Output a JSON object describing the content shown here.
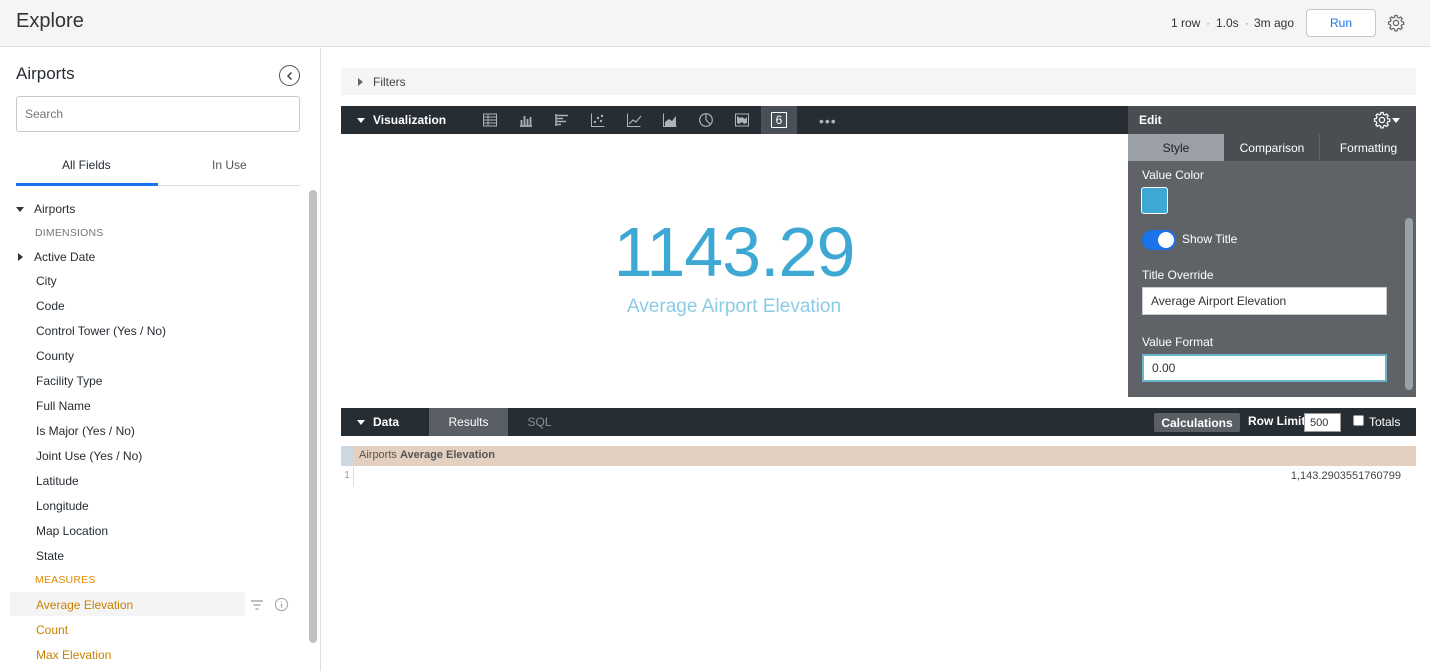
{
  "header": {
    "title": "Explore",
    "rows": "1 row",
    "duration": "1.0s",
    "last_run": "3m ago",
    "sep": "·",
    "run_label": "Run"
  },
  "sidebar": {
    "title": "Airports",
    "search_placeholder": "Search",
    "tabs": [
      {
        "label": "All Fields"
      },
      {
        "label": "In Use"
      }
    ],
    "group": "Airports",
    "dimensions_label": "DIMENSIONS",
    "dimensions": [
      "Active Date",
      "City",
      "Code",
      "Control Tower (Yes / No)",
      "County",
      "Facility Type",
      "Full Name",
      "Is Major (Yes / No)",
      "Joint Use (Yes / No)",
      "Latitude",
      "Longitude",
      "Map Location",
      "State"
    ],
    "measures_label": "MEASURES",
    "measures": [
      "Average Elevation",
      "Count",
      "Max Elevation"
    ]
  },
  "filters": {
    "label": "Filters"
  },
  "visualization": {
    "label": "Visualization",
    "single_value_icon": "6",
    "more": "•••",
    "value": "1143.29",
    "title": "Average Airport Elevation",
    "color": "#3ea8d4"
  },
  "edit": {
    "label": "Edit",
    "tabs": [
      "Style",
      "Comparison",
      "Formatting"
    ],
    "value_color_label": "Value Color",
    "show_title_label": "Show Title",
    "show_title": true,
    "title_override_label": "Title Override",
    "title_override_value": "Average Airport Elevation",
    "value_format_label": "Value Format",
    "value_format_value": "0.00"
  },
  "data": {
    "label": "Data",
    "tabs": [
      "Results",
      "SQL"
    ],
    "calculations_label": "Calculations",
    "row_limit_label": "Row Limit",
    "row_limit_value": "500",
    "totals_label": "Totals",
    "column_group": "Airports",
    "column_name": "Average Elevation",
    "row_index": "1",
    "row_value": "1,143.2903551760799"
  }
}
